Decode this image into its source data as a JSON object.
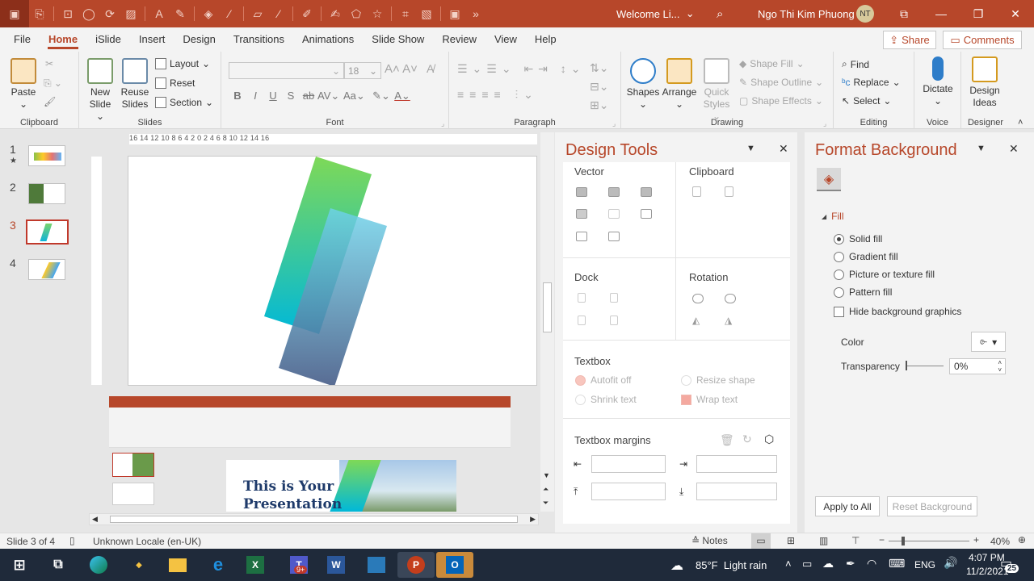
{
  "title_bar": {
    "document_title": "Welcome Li...",
    "user_name": "Ngo Thi Kim Phuong",
    "user_initials": "NT",
    "accent_color": "#b7472a"
  },
  "menu": {
    "tabs": [
      "File",
      "Home",
      "iSlide",
      "Insert",
      "Design",
      "Transitions",
      "Animations",
      "Slide Show",
      "Review",
      "View",
      "Help"
    ],
    "active_tab": "Home",
    "share_label": "Share",
    "comments_label": "Comments"
  },
  "ribbon": {
    "clipboard": {
      "label": "Clipboard",
      "paste": "Paste"
    },
    "slides": {
      "label": "Slides",
      "new_slide_1": "New",
      "new_slide_2": "Slide",
      "reuse_1": "Reuse",
      "reuse_2": "Slides",
      "layout": "Layout",
      "reset": "Reset",
      "section": "Section"
    },
    "font": {
      "label": "Font",
      "size_placeholder": "18"
    },
    "paragraph": {
      "label": "Paragraph"
    },
    "drawing": {
      "label": "Drawing",
      "shapes": "Shapes",
      "arrange": "Arrange",
      "quick_1": "Quick",
      "quick_2": "Styles",
      "shape_fill": "Shape Fill",
      "shape_outline": "Shape Outline",
      "shape_effects": "Shape Effects"
    },
    "editing": {
      "label": "Editing",
      "find": "Find",
      "replace": "Replace",
      "select": "Select"
    },
    "voice": {
      "label": "Voice",
      "dictate": "Dictate"
    },
    "designer": {
      "label": "Designer",
      "design_1": "Design",
      "design_2": "Ideas"
    }
  },
  "thumbnails": [
    {
      "number": "1",
      "star": "★"
    },
    {
      "number": "2"
    },
    {
      "number": "3"
    },
    {
      "number": "4"
    }
  ],
  "ruler_text": "16 14 12 10 8 6 4 2 0 2 4 6 8 10 12 14 16",
  "mini_slide": {
    "heading_line1": "This is Your",
    "heading_line2": "Presentation"
  },
  "design_tools": {
    "title": "Design Tools",
    "vector": "Vector",
    "clipboard": "Clipboard",
    "dock": "Dock",
    "rotation": "Rotation",
    "textbox": "Textbox",
    "autofit_off": "Autofit off",
    "resize_shape": "Resize shape",
    "shrink_text": "Shrink text",
    "wrap_text": "Wrap text",
    "textbox_margins": "Textbox margins"
  },
  "format_background": {
    "title": "Format Background",
    "fill": "Fill",
    "options": [
      "Solid fill",
      "Gradient fill",
      "Picture or texture fill",
      "Pattern fill"
    ],
    "selected": "Solid fill",
    "hide_bg": "Hide background graphics",
    "color_label": "Color",
    "transparency_label": "Transparency",
    "transparency_value": "0%",
    "apply_all": "Apply to All",
    "reset_bg": "Reset Background"
  },
  "status": {
    "slide_info": "Slide 3 of 4",
    "locale": "Unknown Locale (en-UK)",
    "notes": "Notes",
    "zoom": "40%"
  },
  "taskbar": {
    "weather": "85°F  Light rain",
    "lang": "ENG",
    "time": "4:07 PM",
    "date": "11/2/2021",
    "notif_count": "25",
    "badge": "9+"
  }
}
